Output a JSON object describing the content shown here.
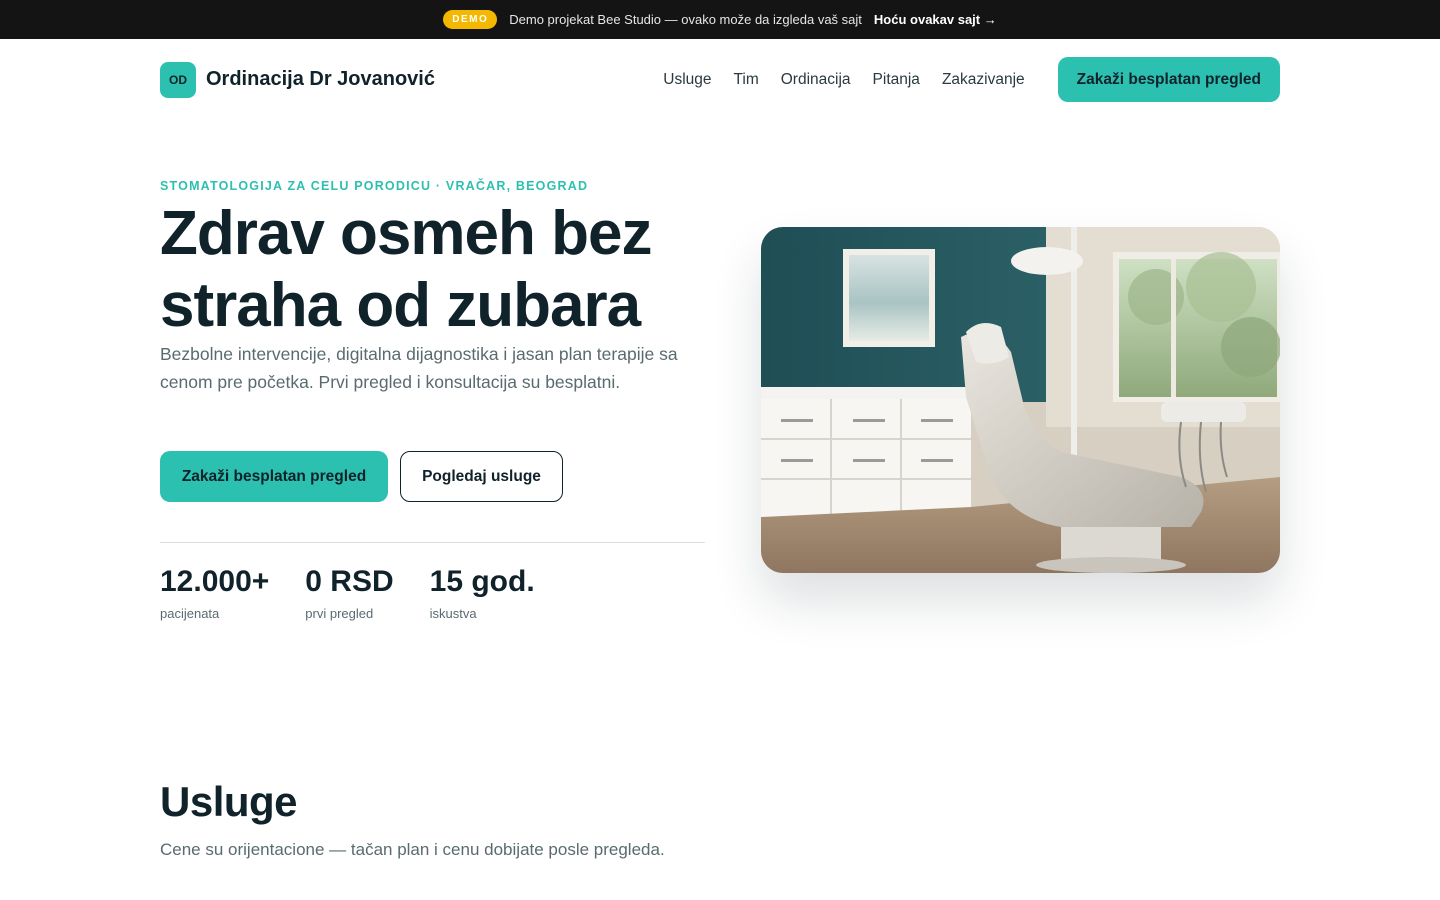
{
  "topbar": {
    "badge": "DEMO",
    "text": "Demo projekat Bee Studio — ovako može da izgleda vaš sajt",
    "link": "Hoću ovakav sajt →"
  },
  "header": {
    "logo_mark": "OD",
    "logo_name": "Ordinacija Dr Jovanović",
    "nav": [
      "Usluge",
      "Tim",
      "Ordinacija",
      "Pitanja",
      "Zakazivanje"
    ],
    "cta": "Zakaži besplatan pregled"
  },
  "hero": {
    "eyebrow": "STOMATOLOGIJA ZA CELU PORODICU · VRAČAR, BEOGRAD",
    "title": "Zdrav osmeh bez straha od zubara",
    "subtitle": "Bezbolne intervencije, digitalna dijagnostika i jasan plan terapije sa cenom pre početka. Prvi pregled i konsultacija su besplatni.",
    "primary_button": "Zakaži besplatan pregled",
    "secondary_button": "Pogledaj usluge",
    "image_subject": "dental-clinic-room-photo",
    "stats": [
      {
        "value": "12.000+",
        "label": "pacijenata"
      },
      {
        "value": "0 RSD",
        "label": "prvi pregled"
      },
      {
        "value": "15 god.",
        "label": "iskustva"
      }
    ]
  },
  "services": {
    "title": "Usluge",
    "subtitle": "Cene su orijentacione — tačan plan i cenu dobijate posle pregleda."
  },
  "colors": {
    "accent": "#2cc0b0",
    "dark": "#10222a",
    "topbar": "#141414",
    "badge": "#f5b800",
    "muted_text": "#5a6b70"
  }
}
